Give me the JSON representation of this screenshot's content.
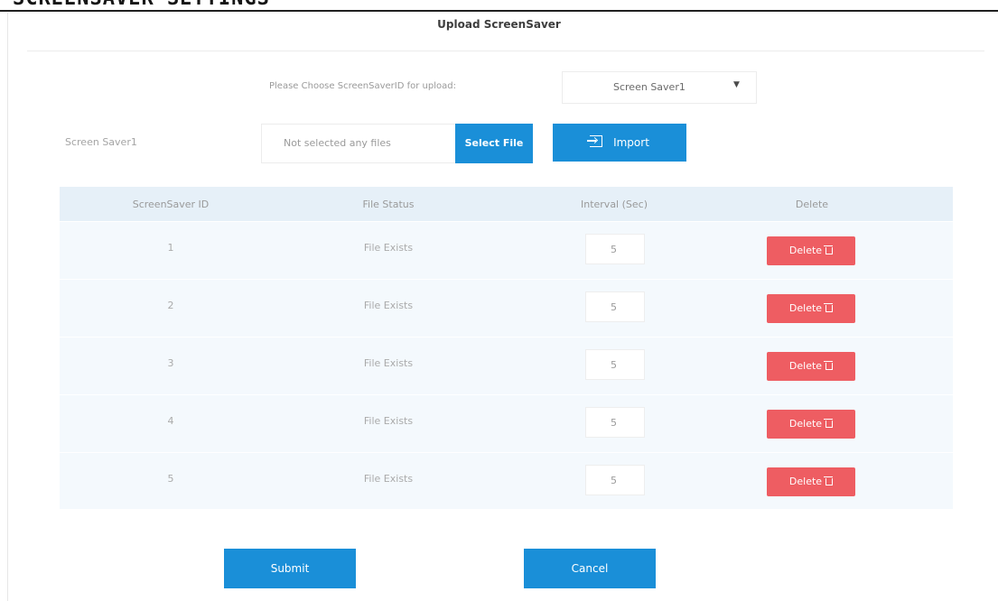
{
  "header": {
    "fragment_text": "SCREENSAVER SETTINGS",
    "title": "Upload ScreenSaver"
  },
  "chooser": {
    "label": "Please Choose ScreenSaverID for upload:",
    "selected": "Screen Saver1",
    "caret_icon": "caret-down-icon"
  },
  "upload": {
    "row_label": "Screen Saver1",
    "file_placeholder": "Not selected any files",
    "select_file_label": "Select File",
    "import_label": "Import",
    "import_icon": "import-icon"
  },
  "table": {
    "headers": [
      "ScreenSaver ID",
      "File Status",
      "Interval (Sec)",
      "Delete"
    ],
    "rows": [
      {
        "id": "1",
        "status": "File Exists",
        "interval": "5",
        "delete_label": "Delete"
      },
      {
        "id": "2",
        "status": "File Exists",
        "interval": "5",
        "delete_label": "Delete"
      },
      {
        "id": "3",
        "status": "File Exists",
        "interval": "5",
        "delete_label": "Delete"
      },
      {
        "id": "4",
        "status": "File Exists",
        "interval": "5",
        "delete_label": "Delete"
      },
      {
        "id": "5",
        "status": "File Exists",
        "interval": "5",
        "delete_label": "Delete"
      }
    ]
  },
  "actions": {
    "submit_label": "Submit",
    "cancel_label": "Cancel"
  },
  "colors": {
    "primary_button": "#1a8fd8",
    "delete_button": "#ee5d62",
    "table_header_bg": "#e6f0f8",
    "table_body_bg": "#f4f9fd"
  }
}
